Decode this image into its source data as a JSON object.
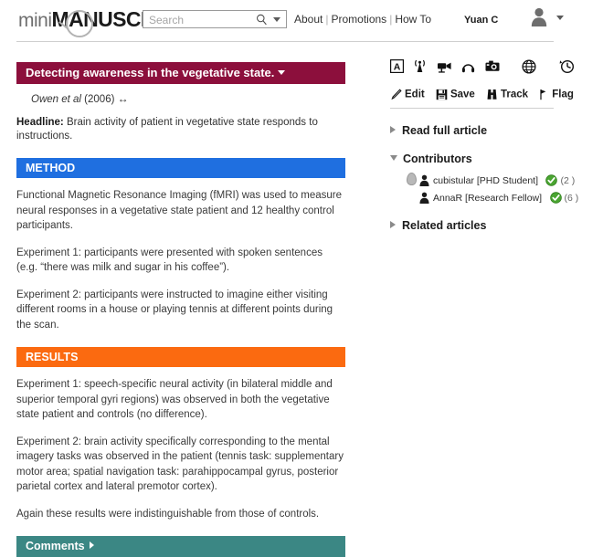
{
  "header": {
    "logo_part1": "mini",
    "logo_part2": "MANUSCRIPT",
    "search": {
      "placeholder": "Search",
      "value": ""
    },
    "nav": [
      {
        "label": "About"
      },
      {
        "label": "Promotions"
      },
      {
        "label": "How To"
      }
    ],
    "nav_separator": "|",
    "user": {
      "name": "Yuan C"
    }
  },
  "article": {
    "title": "Detecting awareness in the vegetative state.",
    "citation": "Owen et al (2006)",
    "citation_arrows": "↔",
    "headline_label": "Headline:",
    "headline_text": "Brain activity of patient in vegetative state responds to instructions.",
    "sections": [
      {
        "id": "method",
        "label": "METHOD",
        "color": "#1f6fe0",
        "paragraphs": [
          "Functional Magnetic Resonance Imaging (fMRI) was used to measure neural responses in a vegetative state patient and 12 healthy control participants.",
          "Experiment 1: participants were presented with spoken sentences (e.g. “there was milk and sugar in his coffee”).",
          "Experiment 2: participants were instructed to imagine either visiting different rooms in a house or playing tennis at different points during the scan."
        ]
      },
      {
        "id": "results",
        "label": "RESULTS",
        "color": "#fb6a10",
        "paragraphs": [
          "Experiment 1: speech-specific neural activity (in bilateral middle and superior temporal gyri regions) was observed in both the vegetative state patient and controls (no difference).",
          "Experiment 2: brain activity specifically corresponding to the mental imagery tasks was observed in the patient (tennis task: supplementary motor area; spatial navigation task: parahippocampal gyrus, posterior parietal cortex and lateral premotor cortex).",
          "Again these results were indistinguishable from those of controls."
        ]
      }
    ],
    "comments_label": "Comments",
    "title_bar_color": "#8c0f3c",
    "comments_bar_color": "#3b8784"
  },
  "sidebar": {
    "media_icons": [
      {
        "name": "text-icon",
        "title": "A"
      },
      {
        "name": "antenna-icon",
        "title": "broadcast"
      },
      {
        "name": "video-camera-icon",
        "title": "video"
      },
      {
        "name": "headphones-icon",
        "title": "audio"
      },
      {
        "name": "camera-icon",
        "title": "photo"
      },
      {
        "name": "globe-icon",
        "title": "web"
      },
      {
        "name": "clock-history-icon",
        "title": "history"
      }
    ],
    "actions": [
      {
        "name": "edit-action",
        "icon": "pencil-icon",
        "label": "Edit"
      },
      {
        "name": "save-action",
        "icon": "floppy-disk-icon",
        "label": "Save"
      },
      {
        "name": "track-action",
        "icon": "binoculars-icon",
        "label": "Track"
      },
      {
        "name": "flag-action",
        "icon": "flag-icon",
        "label": "Flag"
      }
    ],
    "sections": [
      {
        "id": "read-full-article",
        "label": "Read full article",
        "expanded": false
      },
      {
        "id": "contributors",
        "label": "Contributors",
        "expanded": true
      },
      {
        "id": "related-articles",
        "label": "Related articles",
        "expanded": false
      }
    ],
    "contributors": [
      {
        "username": "cubistular",
        "role": "[PHD Student]",
        "verified": true,
        "count": "(2 )",
        "has_egg_badge": true
      },
      {
        "username": "AnnaR",
        "role": "[Research Fellow]",
        "verified": true,
        "count": "(6 )",
        "has_egg_badge": false
      }
    ]
  }
}
